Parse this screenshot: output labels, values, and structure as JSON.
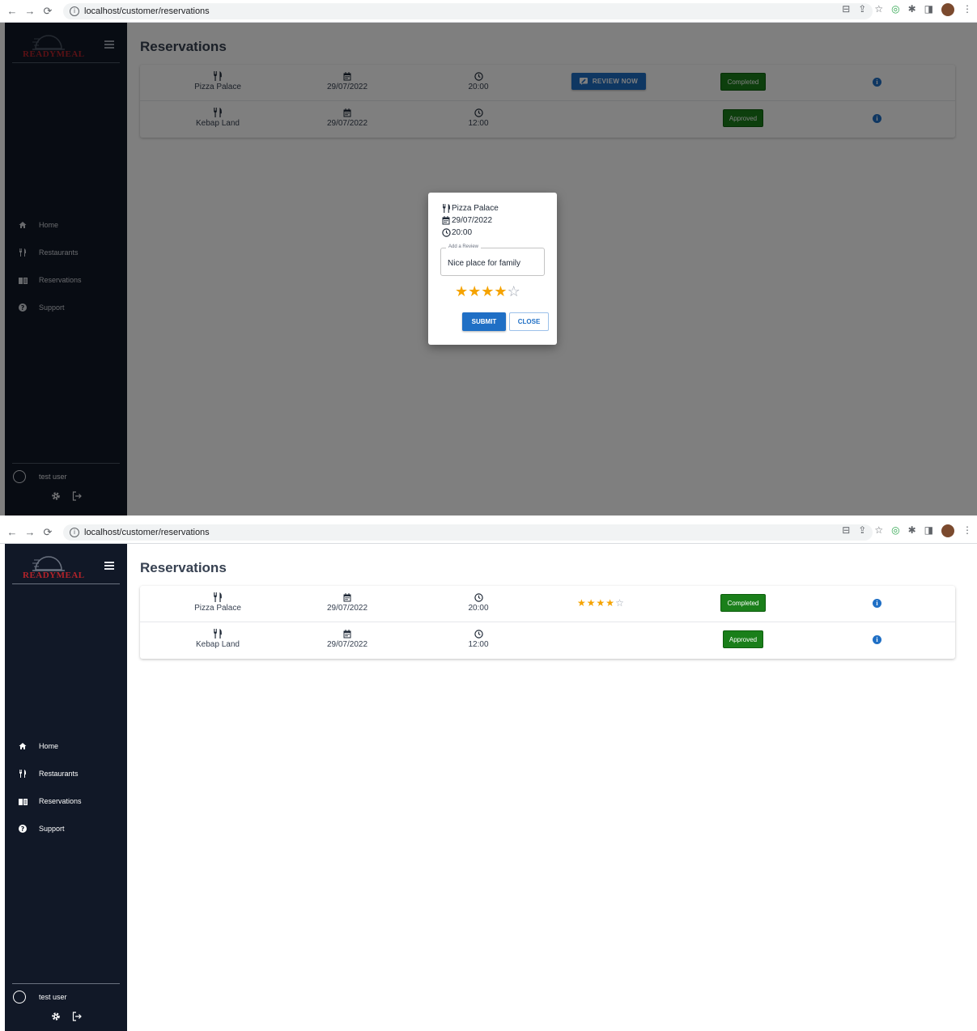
{
  "browser": {
    "url": "localhost/customer/reservations"
  },
  "sidebar": {
    "logo_text": "READYMEAL",
    "items": [
      {
        "label": "Home",
        "icon": "home-icon"
      },
      {
        "label": "Restaurants",
        "icon": "utensils-icon"
      },
      {
        "label": "Reservations",
        "icon": "book-icon"
      },
      {
        "label": "Support",
        "icon": "question-icon"
      }
    ],
    "user": {
      "name": "test user"
    }
  },
  "main": {
    "title": "Reservations",
    "reservations": [
      {
        "restaurant": "Pizza Palace",
        "date": "29/07/2022",
        "time": "20:00",
        "status": "Completed",
        "review_label": "REVIEW NOW",
        "rating": 4,
        "rating_max": 5
      },
      {
        "restaurant": "Kebap Land",
        "date": "29/07/2022",
        "time": "12:00",
        "status": "Approved"
      }
    ]
  },
  "dialog": {
    "restaurant": "Pizza Palace",
    "date": "29/07/2022",
    "time": "20:00",
    "review_legend": "Add a Review",
    "review_value": "Nice place for family",
    "rating": 4,
    "rating_max": 5,
    "submit_label": "SUBMIT",
    "close_label": "CLOSE"
  },
  "colors": {
    "sidebar_bg": "#111827",
    "primary": "#1f6fc5",
    "status_green": "#1a7f1a",
    "star": "#f5a300",
    "logo_red": "#b3232a"
  }
}
